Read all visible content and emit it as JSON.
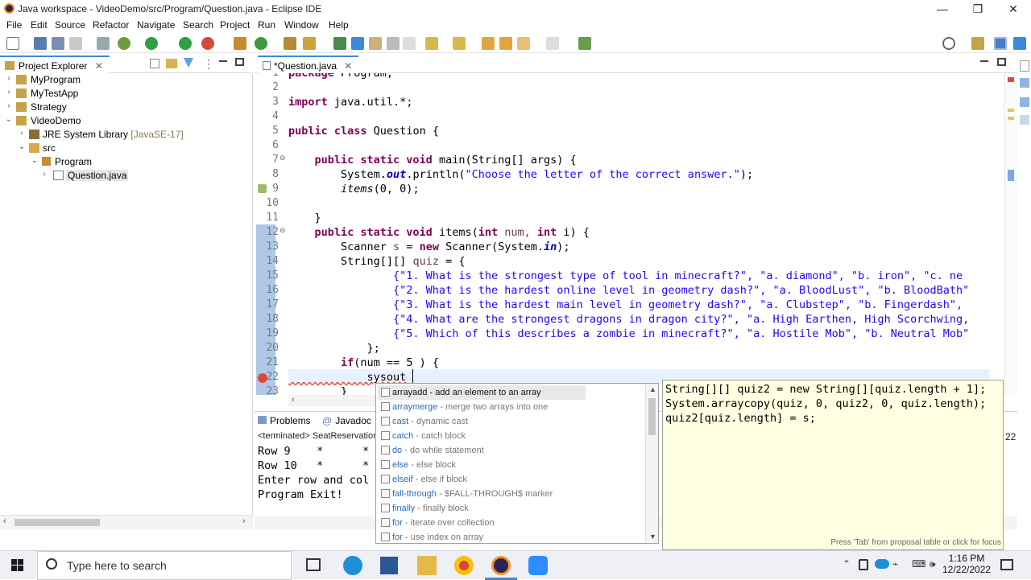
{
  "window": {
    "title": "Java workspace - VideoDemo/src/Program/Question.java - Eclipse IDE",
    "minimize": "—",
    "maximize": "❐",
    "close": "✕"
  },
  "menu": [
    "File",
    "Edit",
    "Source",
    "Refactor",
    "Navigate",
    "Search",
    "Project",
    "Run",
    "Window",
    "Help"
  ],
  "explorer": {
    "title": "Project Explorer",
    "tree": [
      {
        "label": "MyProgram",
        "decor": ""
      },
      {
        "label": "MyTestApp",
        "decor": ""
      },
      {
        "label": "Strategy",
        "decor": ""
      },
      {
        "label": "VideoDemo",
        "decor": ""
      },
      {
        "label": "JRE System Library",
        "decor": "[JavaSE-17]"
      },
      {
        "label": "src",
        "decor": ""
      },
      {
        "label": "Program",
        "decor": ""
      },
      {
        "label": "Question.java",
        "decor": ""
      }
    ]
  },
  "editor": {
    "tab": "*Question.java",
    "lines": [
      "1",
      "2",
      "3",
      "4",
      "5",
      "6",
      "7",
      "8",
      "9",
      "10",
      "11",
      "12",
      "13",
      "14",
      "15",
      "16",
      "17",
      "18",
      "19",
      "20",
      "21",
      "22",
      "23"
    ],
    "code": {
      "l1": "package Program;",
      "l3a": "import",
      "l3b": " java.util.*;",
      "l5a": "public class",
      "l5b": " Question {",
      "l7a": "    public static void",
      "l7b": " main(String[] args) {",
      "l8a": "        System.",
      "l8b": "out",
      "l8c": ".println(",
      "l8d": "\"Choose the letter of the correct answer.\"",
      "l8e": ");",
      "l9a": "        ",
      "l9b": "items",
      "l9c": "(0, 0);",
      "l11": "    }",
      "l12a": "    public static void",
      "l12b": " items(",
      "l12c": "int",
      "l12d": " num, ",
      "l12e": "int",
      "l12f": " i) {",
      "l13a": "        Scanner ",
      "l13b": "s",
      "l13c": " = ",
      "l13d": "new",
      "l13e": " Scanner(System.",
      "l13f": "in",
      "l13g": ");",
      "l14a": "        String[][] ",
      "l14b": "quiz",
      "l14c": " = {",
      "l15": "                {\"1. What is the strongest type of tool in minecraft?\", \"a. diamond\", \"b. iron\", \"c. ne",
      "l16": "                {\"2. What is the hardest online level in geometry dash?\", \"a. BloodLust\", \"b. BloodBath\"",
      "l17": "                {\"3. What is the hardest main level in geometry dash?\", \"a. Clubstep\", \"b. Fingerdash\",",
      "l18": "                {\"4. What are the strongest dragons in dragon city?\", \"a. High Earthen, High Scorchwing,",
      "l19": "                {\"5. Which of this describes a zombie in minecraft?\", \"a. Hostile Mob\", \"b. Neutral Mob\"",
      "l20": "            };",
      "l21a": "        ",
      "l21b": "if",
      "l21c": "(num == 5 ) {",
      "l22": "            sysout",
      "l23": "        }"
    }
  },
  "bottom": {
    "tab_problems": "Problems",
    "tab_javadoc": "Javadoc",
    "terminated": "<terminated> SeatReservation",
    "console": [
      "Row 9    *      *",
      "Row 10   *      *",
      "Enter row and col",
      "Program Exit!"
    ],
    "timestamp_frag": "22"
  },
  "proposals": {
    "items": [
      {
        "name": "arrayadd",
        "desc": " - add an element to an array"
      },
      {
        "name": "arraymerge",
        "desc": " - merge two arrays into one"
      },
      {
        "name": "cast",
        "desc": " - dynamic cast"
      },
      {
        "name": "catch",
        "desc": " - catch block"
      },
      {
        "name": "do",
        "desc": " - do while statement"
      },
      {
        "name": "else",
        "desc": " - else block"
      },
      {
        "name": "elseif",
        "desc": " - else if block"
      },
      {
        "name": "fall-through",
        "desc": " - $FALL-THROUGH$ marker"
      },
      {
        "name": "finally",
        "desc": " - finally block"
      },
      {
        "name": "for",
        "desc": " - iterate over collection"
      },
      {
        "name": "for",
        "desc": " - use index on array"
      }
    ],
    "selected_index": 0
  },
  "doc": {
    "lines": [
      "String[][] quiz2 = new String[][quiz.length + 1];",
      "System.arraycopy(quiz, 0, quiz2, 0, quiz.length);",
      "quiz2[quiz.length] = s;"
    ],
    "hint": "Press 'Tab' from proposal table or click for focus"
  },
  "taskbar": {
    "search_placeholder": "Type here to search",
    "time": "1:16 PM",
    "date": "12/22/2022"
  },
  "colors": {
    "accent": "#3b8ad9",
    "keyword": "#7f0055",
    "string": "#2a00ff",
    "selection": "#e8e8e8"
  }
}
